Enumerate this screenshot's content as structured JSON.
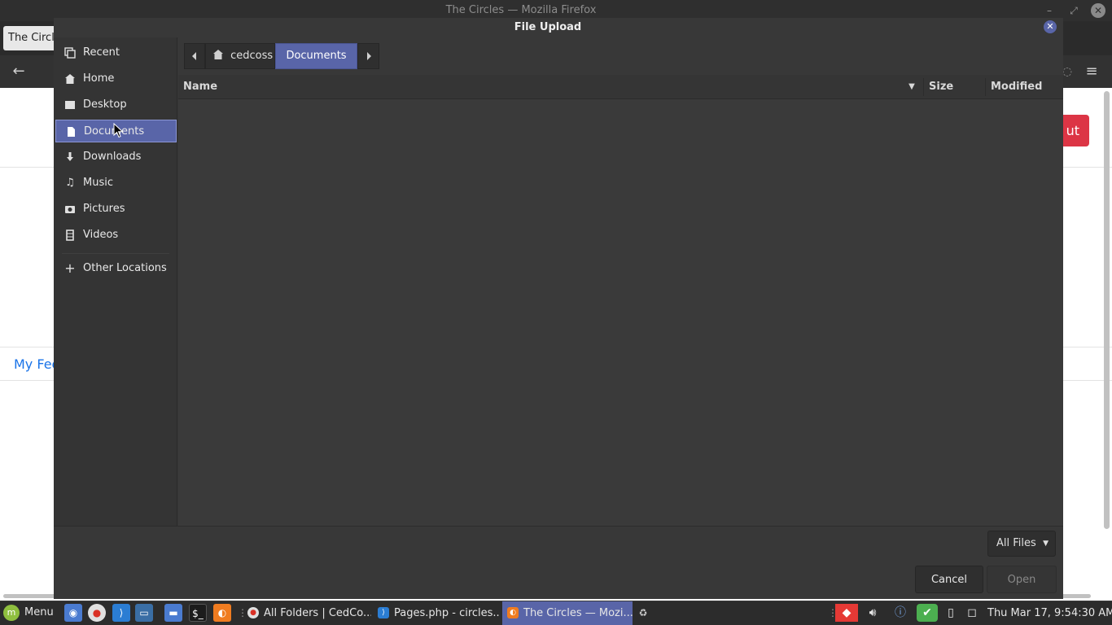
{
  "browser": {
    "window_title": "The Circles — Mozilla Firefox",
    "tab_label": "The Circle",
    "page_button_label": "ut",
    "page_feed_label": "My Fee"
  },
  "dialog": {
    "title": "File Upload",
    "sidebar": {
      "items": [
        {
          "label": "Recent",
          "icon": "recent-icon"
        },
        {
          "label": "Home",
          "icon": "home-icon"
        },
        {
          "label": "Desktop",
          "icon": "desktop-icon"
        },
        {
          "label": "Documents",
          "icon": "documents-icon",
          "selected": true
        },
        {
          "label": "Downloads",
          "icon": "downloads-icon"
        },
        {
          "label": "Music",
          "icon": "music-icon"
        },
        {
          "label": "Pictures",
          "icon": "pictures-icon"
        },
        {
          "label": "Videos",
          "icon": "videos-icon"
        },
        {
          "label": "Other Locations",
          "icon": "plus-icon"
        }
      ]
    },
    "path_bar": {
      "segments": [
        "cedcoss",
        "Documents"
      ],
      "active_segment": "Documents"
    },
    "columns": {
      "name": "Name",
      "size": "Size",
      "modified": "Modified"
    },
    "filter": {
      "selected": "All Files"
    },
    "buttons": {
      "cancel": "Cancel",
      "open": "Open"
    }
  },
  "taskbar": {
    "menu_label": "Menu",
    "tasks": [
      {
        "label": "All Folders | CedCo...",
        "icon": "chrome-icon"
      },
      {
        "label": "Pages.php - circles...",
        "icon": "vscode-icon"
      },
      {
        "label": "The Circles — Mozi...",
        "icon": "firefox-icon",
        "active": true
      }
    ],
    "clock": "Thu Mar 17,  9:54:30 AM"
  },
  "colors": {
    "accent": "#5965a8",
    "dialog_bg": "#383838",
    "sidebar_bg": "#343434",
    "taskbar_bg": "#2c2c2c",
    "logout_red": "#dc3545"
  }
}
